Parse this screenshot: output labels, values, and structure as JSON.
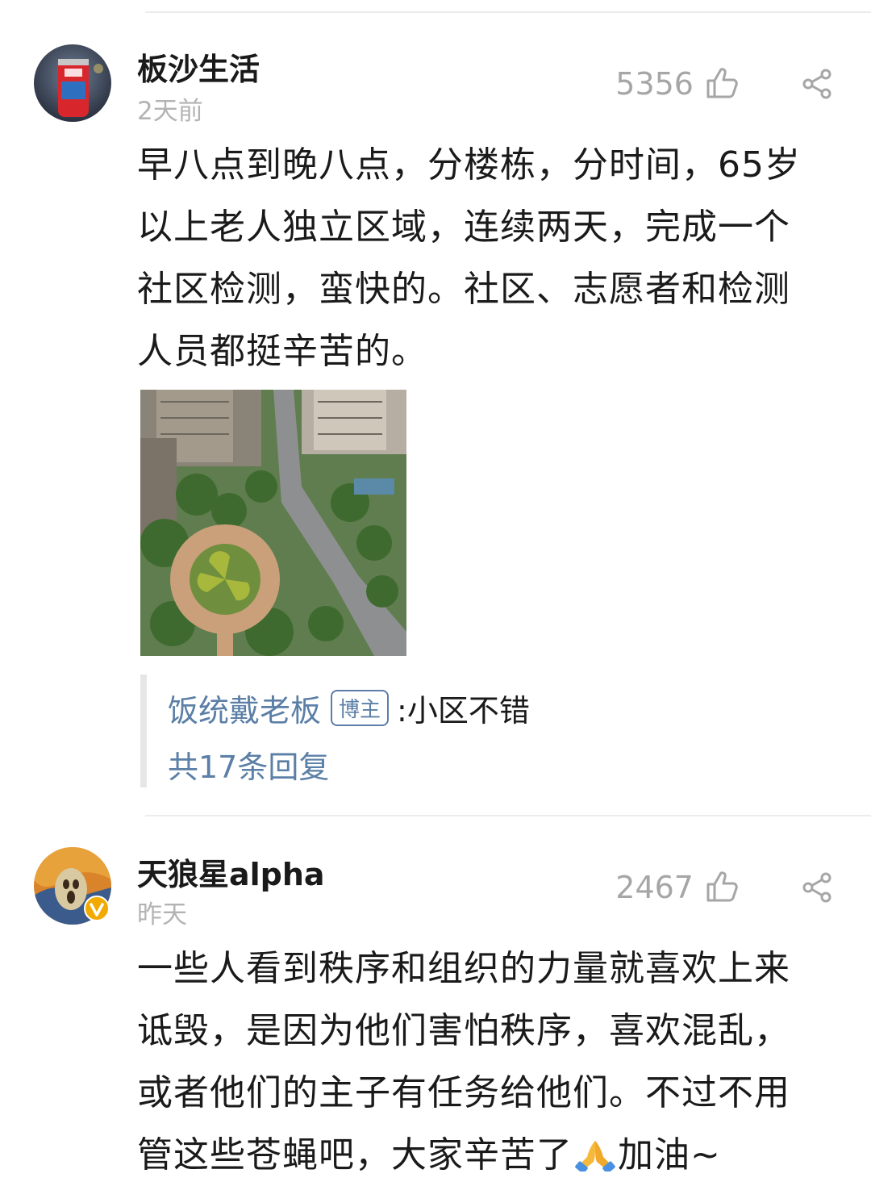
{
  "comments": [
    {
      "username": "板沙生活",
      "time": "2天前",
      "likes": "5356",
      "lines": [
        "早八点到晚八点，分楼栋，分时间，65岁",
        "以上老人独立区域，连续两天，完成一个",
        "社区检测，蛮快的。社区、志愿者和检测",
        "人员都挺辛苦的。"
      ],
      "reply": {
        "user": "饭统戴老板",
        "badge": "博主",
        "text": ":小区不错",
        "count": "共17条回复"
      }
    },
    {
      "username": "天狼星alpha",
      "time": "昨天",
      "likes": "2467",
      "lines": [
        "一些人看到秩序和组织的力量就喜欢上来",
        "诋毁，是因为他们害怕秩序，喜欢混乱，",
        "或者他们的主子有任务给他们。不过不用"
      ],
      "last_line_a": "管这些苍蝇吧，大家辛苦了",
      "last_line_b": "加油~"
    }
  ],
  "icons": {
    "like": "thumbs-up-outline-icon",
    "share": "share-icon",
    "emoji": "folded-hands-emoji",
    "verified": "verified-badge-icon"
  },
  "colors": {
    "link": "#5b7fa6",
    "meta": "#b3b3b3",
    "verified": "#f2a900"
  }
}
